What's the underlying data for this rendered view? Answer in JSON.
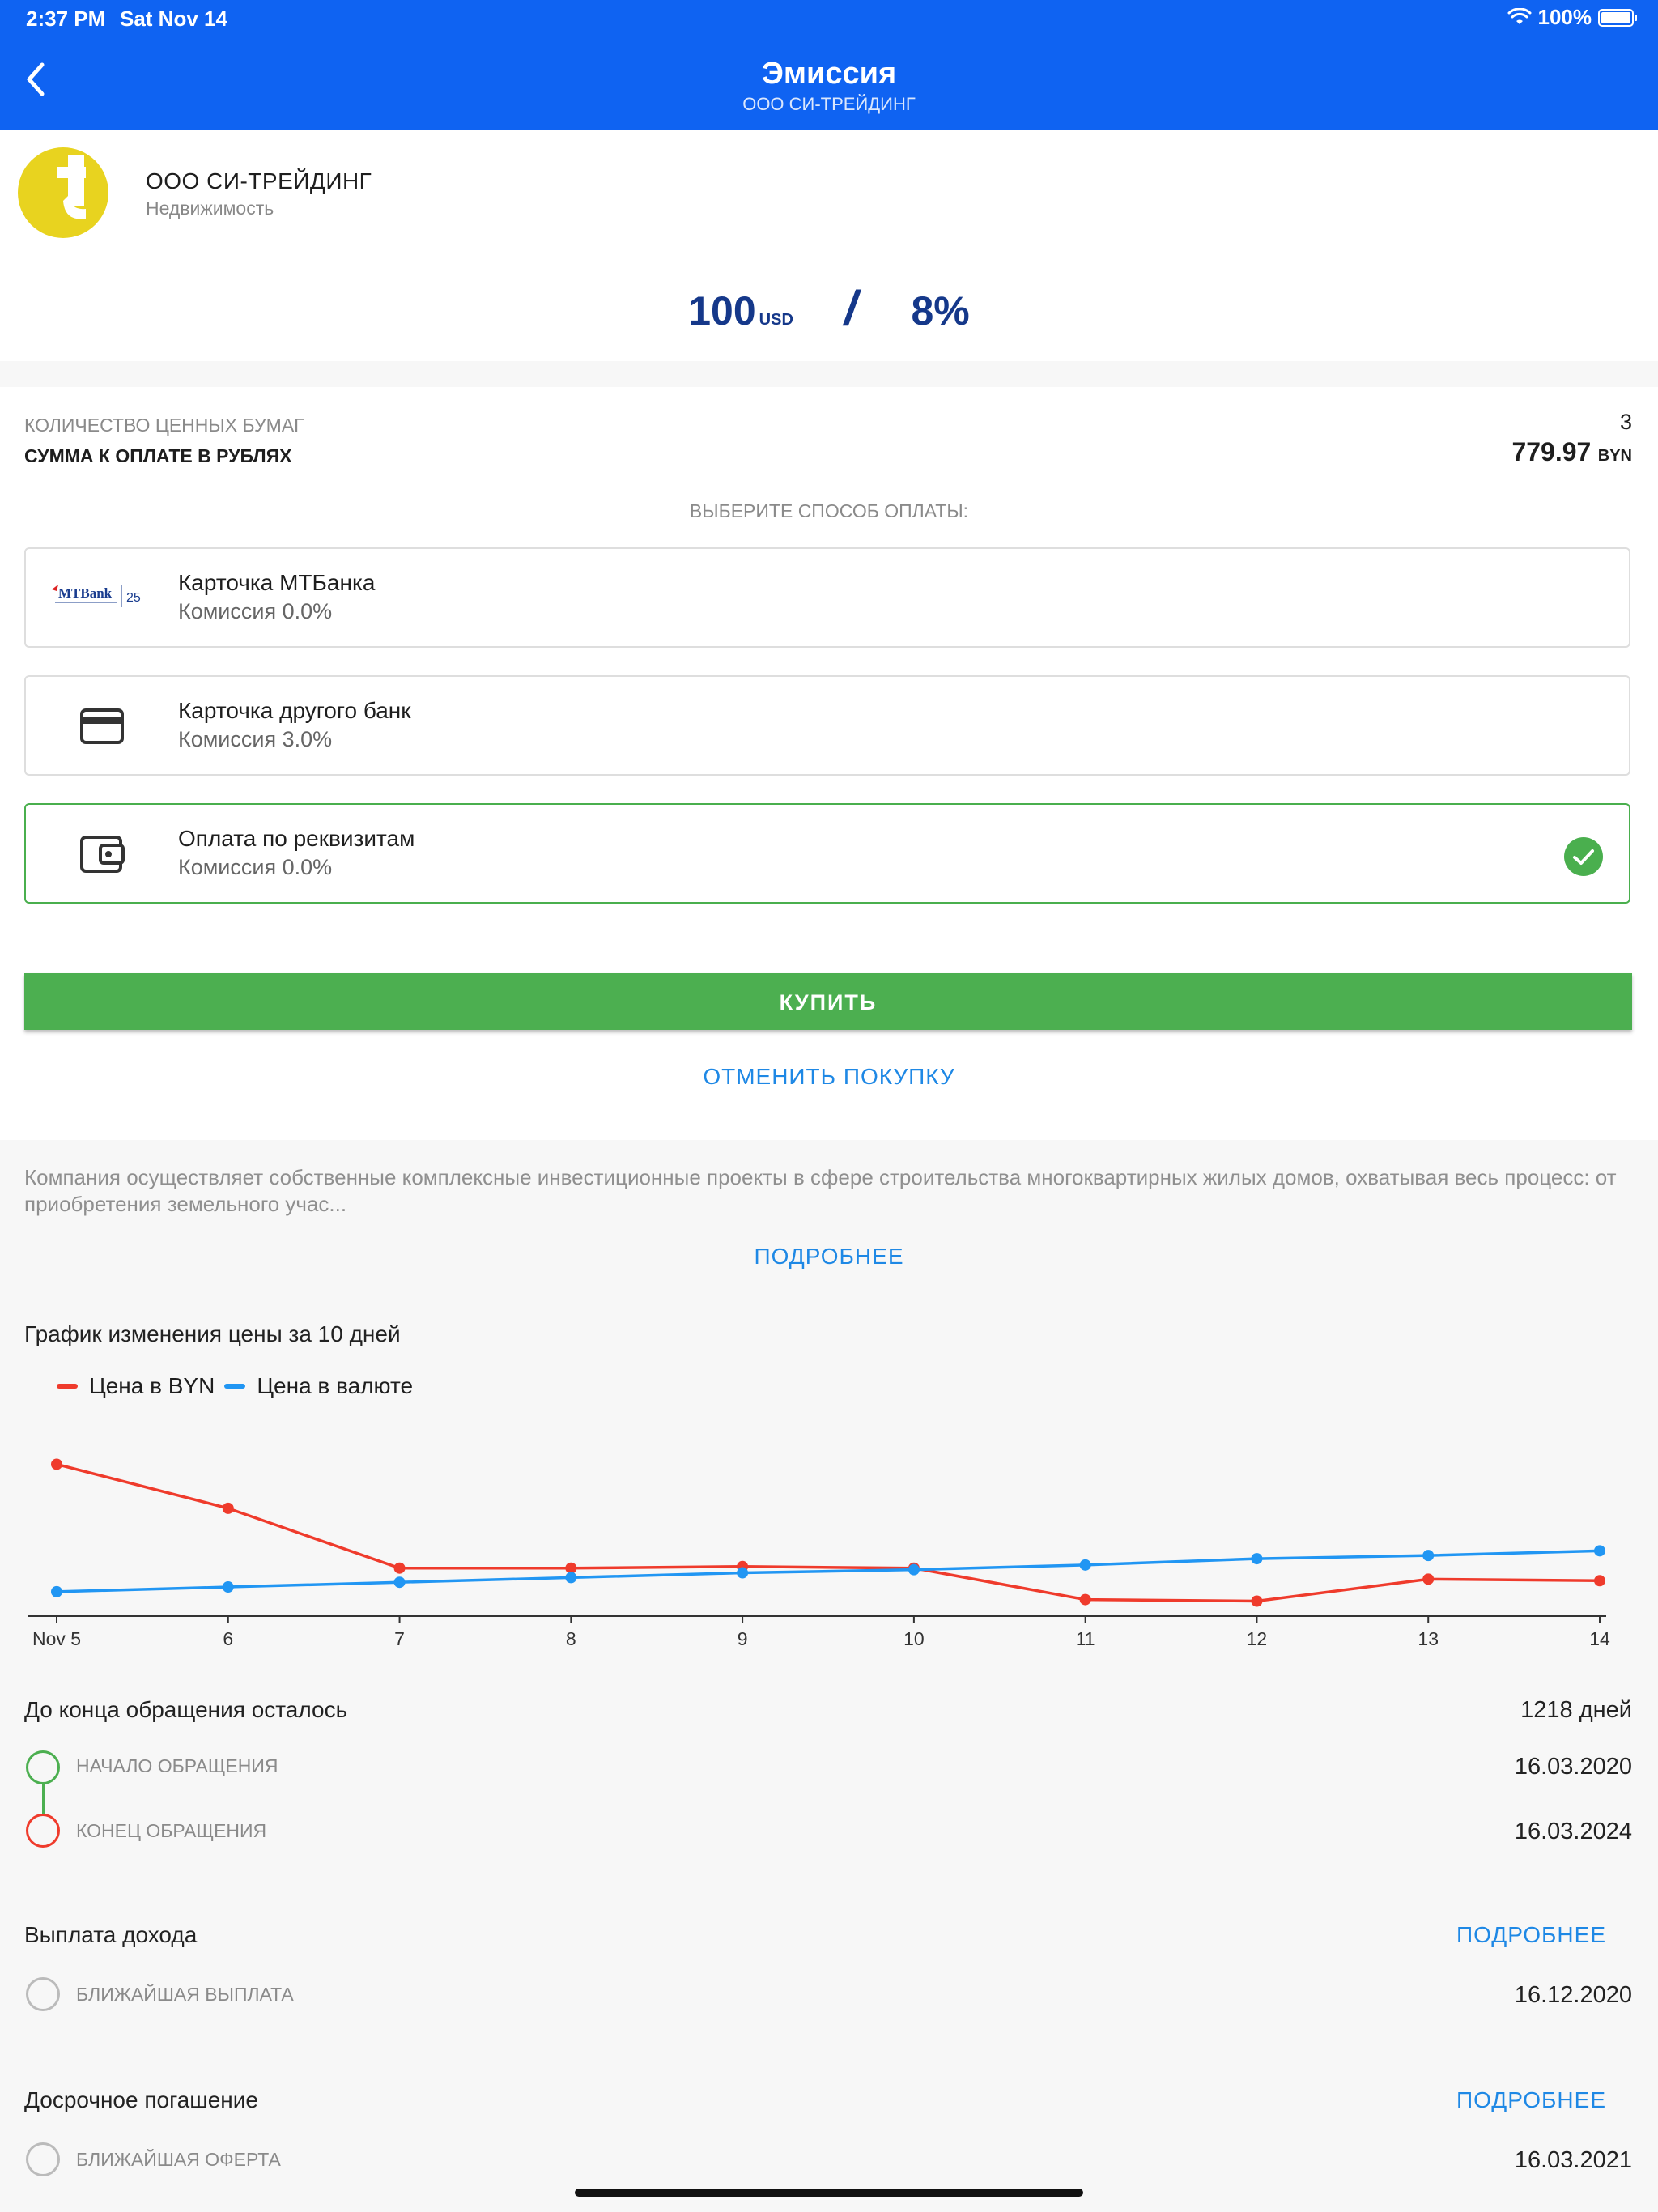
{
  "status_bar": {
    "time": "2:37 PM",
    "date": "Sat Nov 14",
    "battery": "100%"
  },
  "header": {
    "title": "Эмиссия",
    "subtitle": "ООО СИ-ТРЕЙДИНГ"
  },
  "company": {
    "name": "ООО СИ-ТРЕЙДИНГ",
    "sector": "Недвижимость",
    "logo_letter": "t",
    "logo_color": "#e8d31f"
  },
  "price": {
    "value": "100",
    "currency": "USD",
    "separator": "/",
    "rate": "8%"
  },
  "order": {
    "quantity_label": "КОЛИЧЕСТВО ЦЕННЫХ БУМАГ",
    "quantity_value": "3",
    "sum_label": "СУММА К ОПЛАТЕ В РУБЛЯХ",
    "sum_value": "779.97",
    "sum_currency": "BYN"
  },
  "payment": {
    "prompt": "ВЫБЕРИТЕ СПОСОБ ОПЛАТЫ:",
    "options": [
      {
        "title": "Карточка МТБанка",
        "fee": "Комиссия 0.0%",
        "icon": "mtbank-logo",
        "logo_text": "MTBank",
        "logo_sub": "25",
        "selected": false
      },
      {
        "title": "Карточка другого банк",
        "fee": "Комиссия 3.0%",
        "icon": "credit-card-icon",
        "selected": false
      },
      {
        "title": "Оплата по реквизитам",
        "fee": "Комиссия 0.0%",
        "icon": "wallet-icon",
        "selected": true
      }
    ]
  },
  "actions": {
    "buy": "КУПИТЬ",
    "cancel": "ОТМЕНИТЬ ПОКУПКУ"
  },
  "description": {
    "text": "Компания осуществляет собственные комплексные инвестиционные проекты в сфере строительства многоквартирных жилых домов, охватывая весь процесс: от приобретения земельного учас...",
    "more": "ПОДРОБНЕЕ"
  },
  "chart_section": {
    "title": "График изменения цены за 10 дней"
  },
  "chart_data": {
    "type": "line",
    "title": "График изменения цены за 10 дней",
    "categories": [
      "Nov 5",
      "6",
      "7",
      "8",
      "9",
      "10",
      "11",
      "12",
      "13",
      "14"
    ],
    "series": [
      {
        "name": "Цена в BYN",
        "color": "#ef3b2c",
        "values": [
          8.1,
          5.3,
          1.5,
          1.5,
          1.6,
          1.5,
          -0.5,
          -0.6,
          0.8,
          0.7
        ]
      },
      {
        "name": "Цена в валюте",
        "color": "#2196f3",
        "values": [
          0.0,
          0.3,
          0.6,
          0.9,
          1.2,
          1.4,
          1.7,
          2.1,
          2.3,
          2.6
        ]
      }
    ],
    "grid": false,
    "legend": "top-left"
  },
  "circulation": {
    "title": "До конца обращения осталось",
    "remaining": "1218 дней",
    "start_label": "НАЧАЛО ОБРАЩЕНИЯ",
    "start_date": "16.03.2020",
    "end_label": "КОНЕЦ ОБРАЩЕНИЯ",
    "end_date": "16.03.2024"
  },
  "income": {
    "title": "Выплата дохода",
    "more": "ПОДРОБНЕЕ",
    "next_label": "БЛИЖАЙШАЯ ВЫПЛАТА",
    "next_date": "16.12.2020"
  },
  "redemption": {
    "title": "Досрочное погашение",
    "more": "ПОДРОБНЕЕ",
    "next_label": "БЛИЖАЙШАЯ ОФЕРТА",
    "next_date": "16.03.2021"
  },
  "colors": {
    "header": "#0f63f2",
    "accent_blue": "#1e88e5",
    "success": "#4caf50",
    "danger": "#ef3b2c",
    "price": "#15388a"
  }
}
